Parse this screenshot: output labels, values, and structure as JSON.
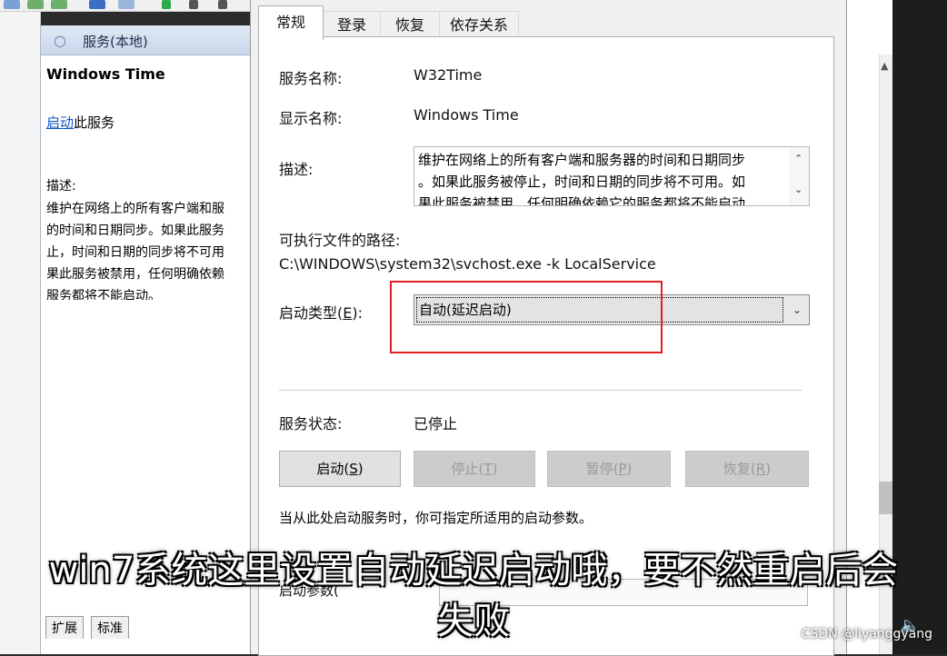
{
  "background": {
    "services_panel": {
      "header": "服务(本地)",
      "service_name": "Windows Time",
      "start_link": "启动",
      "start_suffix": "此服务",
      "desc_label": "描述:",
      "desc_lines": [
        "维护在网络上的所有客户端和服",
        "的时间和日期同步。如果此服务",
        "止，时间和日期的同步将不可用",
        "果此服务被禁用，任何明确依赖",
        "服务都将不能启动。"
      ]
    },
    "bottom_tabs": [
      "扩展",
      "标准"
    ]
  },
  "dialog": {
    "tabs": [
      {
        "label": "常规",
        "active": true
      },
      {
        "label": "登录",
        "active": false
      },
      {
        "label": "恢复",
        "active": false
      },
      {
        "label": "依存关系",
        "active": false
      }
    ],
    "service_name_label": "服务名称:",
    "service_name_value": "W32Time",
    "display_name_label": "显示名称:",
    "display_name_value": "Windows Time",
    "description_label": "描述:",
    "description_lines": [
      "维护在网络上的所有客户端和服务器的时间和日期同步",
      "。如果此服务被停止，时间和日期的同步将不可用。如",
      "果此服务被禁用，任何明确依赖它的服务都将不能启动"
    ],
    "exe_path_label": "可执行文件的路径:",
    "exe_path_value": "C:\\WINDOWS\\system32\\svchost.exe -k LocalService",
    "startup_type_label": "启动类型(",
    "startup_type_key": "E",
    "startup_type_label_end": "):",
    "startup_type_value": "自动(延迟启动)",
    "status_label": "服务状态:",
    "status_value": "已停止",
    "buttons": [
      {
        "label": "启动(",
        "key": "S",
        "end": ")",
        "enabled": true
      },
      {
        "label": "停止(",
        "key": "T",
        "end": ")",
        "enabled": false
      },
      {
        "label": "暂停(",
        "key": "P",
        "end": ")",
        "enabled": false
      },
      {
        "label": "恢复(",
        "key": "R",
        "end": ")",
        "enabled": false
      }
    ],
    "hint": "当从此处启动服务时，你可指定所适用的启动参数。",
    "param_label": "启动参数("
  },
  "subtitle": {
    "line1": "win7系统这里设置自动延迟启动哦，要不然重启后会",
    "line2": "失败"
  },
  "watermark": "CSDN @liyanggyang",
  "colors": {
    "highlight_box": "#e02020",
    "link": "#0a56c7"
  }
}
